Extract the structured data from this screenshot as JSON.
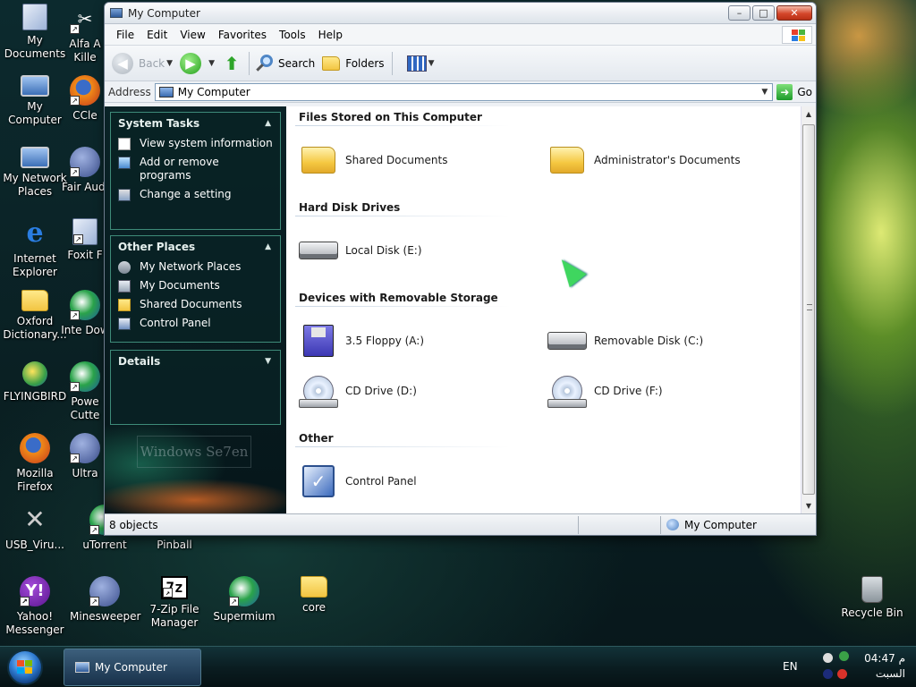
{
  "desktop": {
    "icons": [
      {
        "label": "My Documents"
      },
      {
        "label": "My Computer"
      },
      {
        "label": "My Network Places"
      },
      {
        "label": "Internet Explorer"
      },
      {
        "label": "Oxford Dictionary..."
      },
      {
        "label": "FLYINGBIRD"
      },
      {
        "label": "Mozilla Firefox"
      },
      {
        "label": "USB_Viru..."
      },
      {
        "label": "Alfa A Kille"
      },
      {
        "label": "CCle"
      },
      {
        "label": "Fair Audi"
      },
      {
        "label": "Foxit F"
      },
      {
        "label": "Inte Dow"
      },
      {
        "label": "Powe Cutte"
      },
      {
        "label": "Ultra"
      },
      {
        "label": "uTorrent"
      },
      {
        "label": "Pinball"
      },
      {
        "label": "Yahoo! Messenger"
      },
      {
        "label": "Minesweeper"
      },
      {
        "label": "7-Zip File Manager"
      },
      {
        "label": "Supermium"
      },
      {
        "label": "core"
      },
      {
        "label": "Recycle Bin"
      }
    ]
  },
  "window": {
    "title": "My Computer",
    "title_buttons": {
      "minimize": "–",
      "maximize": "□",
      "close": "✕"
    },
    "menu": [
      "File",
      "Edit",
      "View",
      "Favorites",
      "Tools",
      "Help"
    ],
    "toolbar": {
      "back": "Back",
      "search": "Search",
      "folders": "Folders"
    },
    "address": {
      "label": "Address",
      "value": "My Computer",
      "go": "Go"
    },
    "taskpane": {
      "system_tasks": {
        "title": "System Tasks",
        "links": [
          "View system information",
          "Add or remove programs",
          "Change a setting"
        ]
      },
      "other_places": {
        "title": "Other Places",
        "links": [
          "My Network Places",
          "My Documents",
          "Shared Documents",
          "Control Panel"
        ]
      },
      "details": {
        "title": "Details"
      },
      "watermark": "Windows Se7en"
    },
    "content": {
      "groups": [
        {
          "title": "Files Stored on This Computer",
          "items": [
            "Shared Documents",
            "Administrator's Documents"
          ]
        },
        {
          "title": "Hard Disk Drives",
          "items": [
            "Local Disk (E:)"
          ]
        },
        {
          "title": "Devices with Removable Storage",
          "items": [
            "3.5 Floppy (A:)",
            "Removable Disk (C:)",
            "CD Drive (D:)",
            "CD Drive (F:)"
          ]
        },
        {
          "title": "Other",
          "items": [
            "Control Panel"
          ]
        }
      ]
    },
    "status": {
      "objects": "8 objects",
      "location": "My Computer"
    }
  },
  "taskbar": {
    "task_button": "My Computer",
    "language": "EN",
    "clock_time": "04:47 م",
    "clock_date": "السبت"
  },
  "colors": {
    "desktop_bg": "#0c2a2e",
    "taskpane_border": "#3e8b79",
    "accent_green": "#24a01c"
  }
}
